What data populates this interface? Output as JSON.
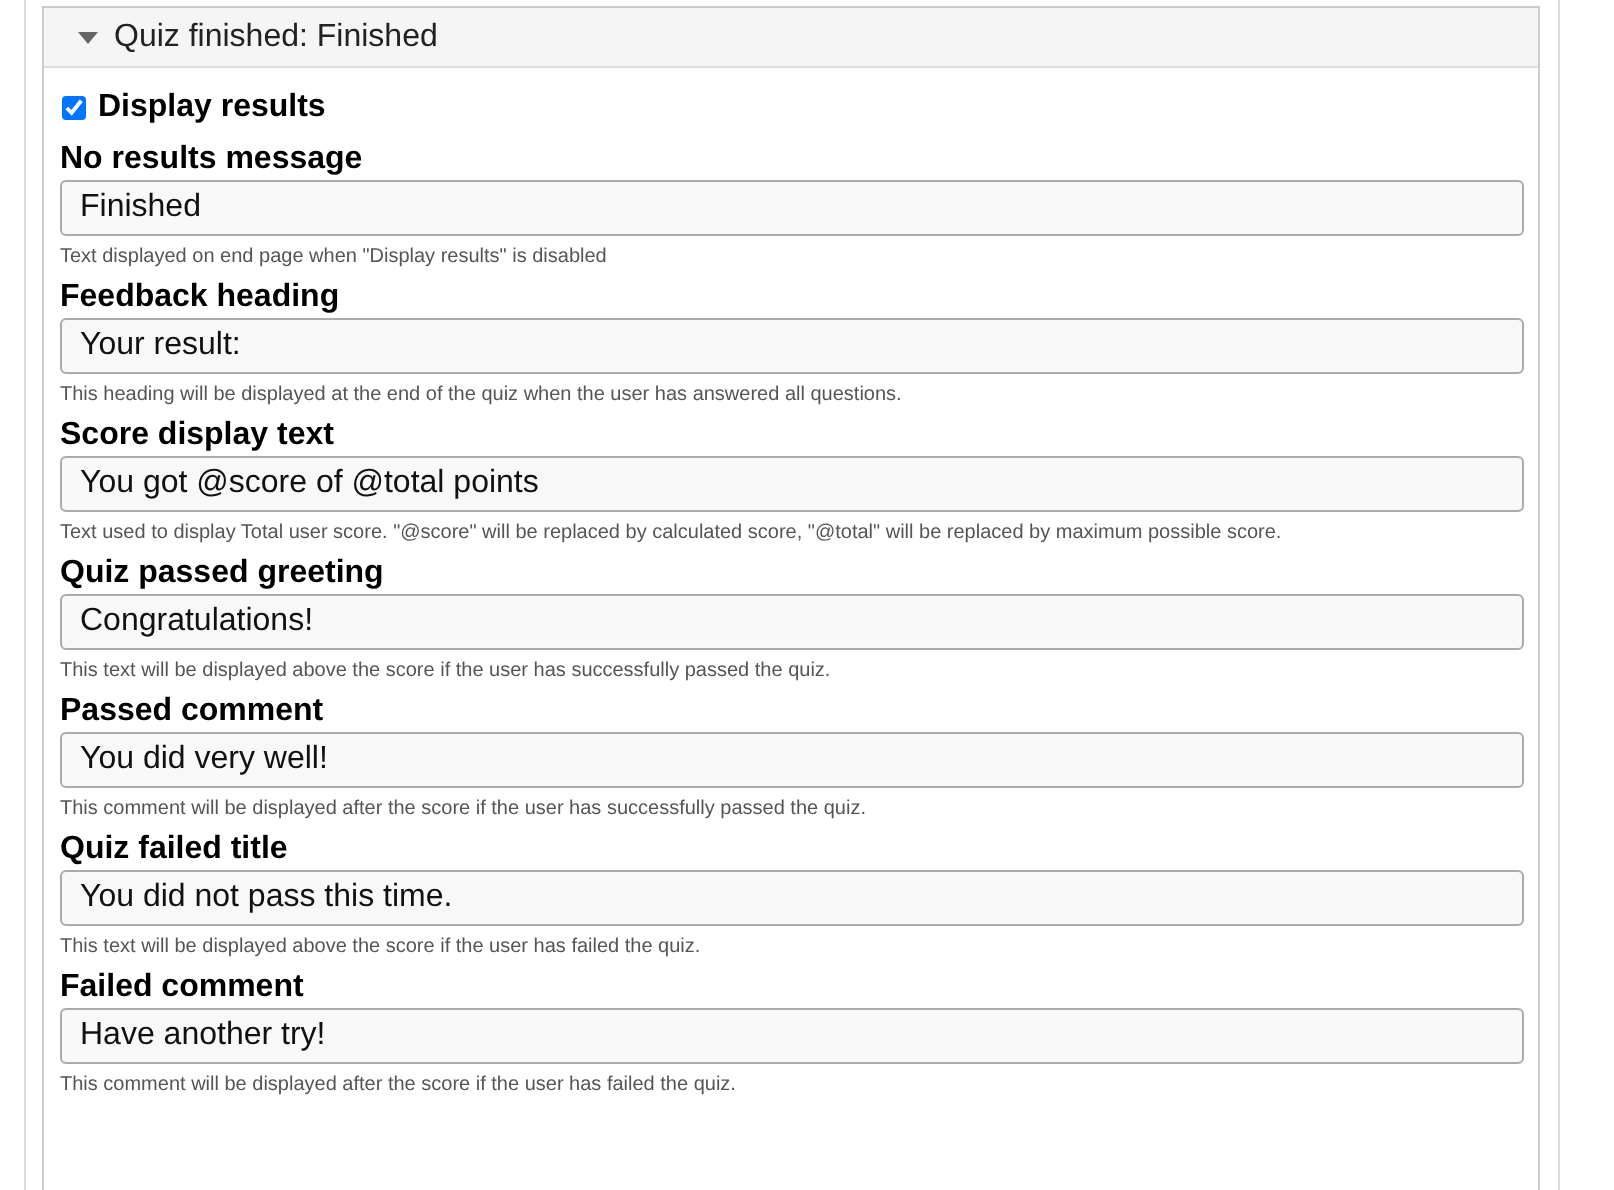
{
  "section": {
    "title": "Quiz finished: Finished",
    "expanded": true
  },
  "display_results": {
    "label": "Display results",
    "checked": true
  },
  "fields": [
    {
      "label": "No results message",
      "value": "Finished",
      "description": "Text displayed on end page when \"Display results\" is disabled"
    },
    {
      "label": "Feedback heading",
      "value": "Your result:",
      "description": "This heading will be displayed at the end of the quiz when the user has answered all questions."
    },
    {
      "label": "Score display text",
      "value": "You got @score of @total points",
      "description": "Text used to display Total user score. \"@score\" will be replaced by calculated score, \"@total\" will be replaced by maximum possible score."
    },
    {
      "label": "Quiz passed greeting",
      "value": "Congratulations!",
      "description": "This text will be displayed above the score if the user has successfully passed the quiz."
    },
    {
      "label": "Passed comment",
      "value": "You did very well!",
      "description": "This comment will be displayed after the score if the user has successfully passed the quiz."
    },
    {
      "label": "Quiz failed title",
      "value": "You did not pass this time.",
      "description": "This text will be displayed above the score if the user has failed the quiz."
    },
    {
      "label": "Failed comment",
      "value": "Have another try!",
      "description": "This comment will be displayed after the score if the user has failed the quiz."
    }
  ]
}
